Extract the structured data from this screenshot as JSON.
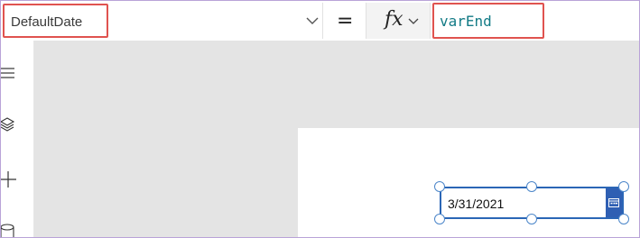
{
  "formula_bar": {
    "property_value": "DefaultDate",
    "equals_symbol": "=",
    "fx_label": "fx",
    "formula_text": "varEnd"
  },
  "left_rail": {
    "items": [
      {
        "icon": "hamburger-menu-icon"
      },
      {
        "icon": "layers-icon"
      },
      {
        "icon": "plus-icon"
      },
      {
        "icon": "database-icon"
      }
    ]
  },
  "date_picker": {
    "value": "3/31/2021",
    "button_icon": "calendar-icon"
  },
  "colors": {
    "highlight_border": "#e0534f",
    "selection_blue": "#2b66b6",
    "formula_text": "#137b86",
    "canvas_background": "#e4e4e4"
  }
}
